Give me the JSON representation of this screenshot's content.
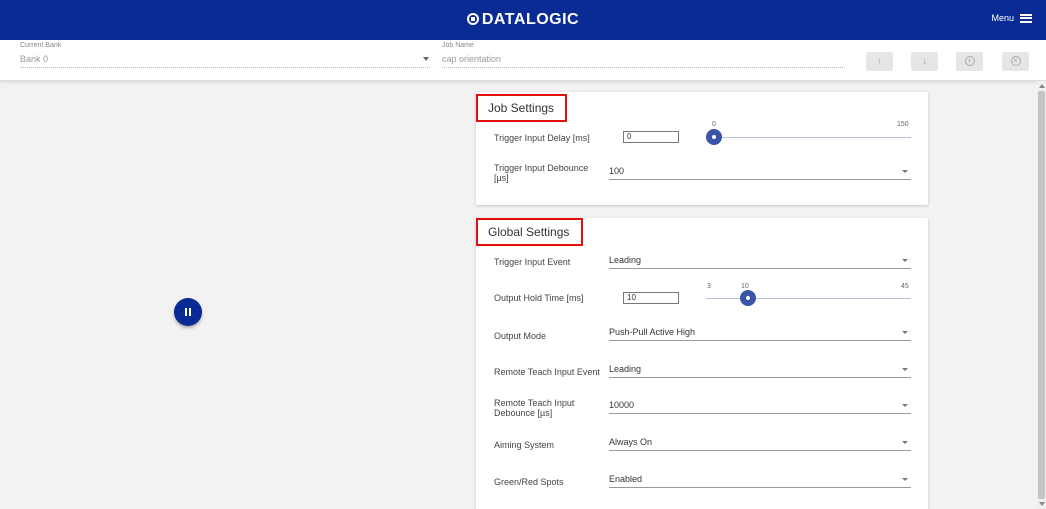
{
  "header": {
    "logo_text": "DATALOGIC",
    "menu_label": "Menu",
    "menu_icon": "hamburger-icon"
  },
  "toolbar": {
    "current_bank_label": "Current Bank",
    "current_bank_value": "Bank 0",
    "job_name_label": "Job Name",
    "job_name_placeholder": "cap orientation",
    "move_up_icon": "↑",
    "move_down_icon": "↓",
    "add_icon": "+",
    "remove_icon": "×"
  },
  "job_settings": {
    "title": "Job Settings",
    "trigger_input_delay": {
      "label": "Trigger Input Delay [ms]",
      "value": "0",
      "slider_min": "0",
      "slider_max": "150",
      "slider_value": 0
    },
    "trigger_input_debounce": {
      "label": "Trigger Input Debounce [µs]",
      "value": "100"
    }
  },
  "global_settings": {
    "title": "Global Settings",
    "trigger_input_event": {
      "label": "Trigger Input Event",
      "value": "Leading"
    },
    "output_hold_time": {
      "label": "Output Hold Time [ms]",
      "value": "10",
      "slider_min": "3",
      "slider_max": "45",
      "slider_current": "10",
      "slider_value": 10
    },
    "output_mode": {
      "label": "Output Mode",
      "value": "Push-Pull Active High"
    },
    "remote_teach_input_event": {
      "label": "Remote Teach Input Event",
      "value": "Leading"
    },
    "remote_teach_input_debounce": {
      "label": "Remote Teach Input Debounce [µs]",
      "value": "10000"
    },
    "aiming_system": {
      "label": "Aiming System",
      "value": "Always On"
    },
    "green_red_spots": {
      "label": "Green/Red Spots",
      "value": "Enabled"
    }
  },
  "colors": {
    "header_bg": "#0b2b94",
    "slider_thumb": "#3a54a8",
    "highlight_box": "#e01010"
  }
}
